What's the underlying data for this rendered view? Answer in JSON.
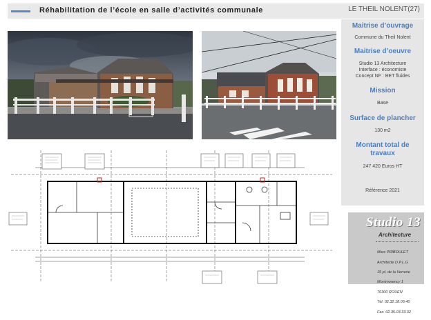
{
  "header": {
    "title": "Réhabilitation de l’école en salle d’activités communale",
    "location": "LE THEIL NOLENT(27)"
  },
  "photos": [
    {
      "name": "photo-after-renovation"
    },
    {
      "name": "photo-before-renovation"
    }
  ],
  "sidebar": {
    "maitrise_ouvrage_label": "Maitrise d’ouvrage",
    "maitrise_ouvrage_value": "Commune du Theil Nolent",
    "maitrise_oeuvre_label": "Maitrise d’oeuvre",
    "maitrise_oeuvre_lines": [
      "Studio 13 Architecture",
      "Interface : économiste",
      "Concept NF : BET fluides"
    ],
    "mission_label": "Mission",
    "mission_value": "Base",
    "surface_label": "Surface de plancher",
    "surface_value": "130 m2",
    "montant_label_lines": [
      "Montant total de",
      "travaux"
    ],
    "montant_value": "247 420 Euros HT",
    "reference": "Référence 2021"
  },
  "logo": {
    "name": "Studio 13",
    "subtitle": "Architecture",
    "contact_lines": [
      "Marc PRIBOULET",
      "Architecte D.P.L.G",
      "15 pl. de la Verrerie",
      "Montmorency 1",
      "76300 ROUEN",
      "Tél. 02.32.18.05.40",
      "Fax. 02.35.03.33.32"
    ]
  },
  "colors": {
    "accent": "#4a7fc0",
    "header_bg": "#e9e9e9",
    "sidebar_bg": "#e6e6e6",
    "logo_bg": "#c9c9c9"
  }
}
